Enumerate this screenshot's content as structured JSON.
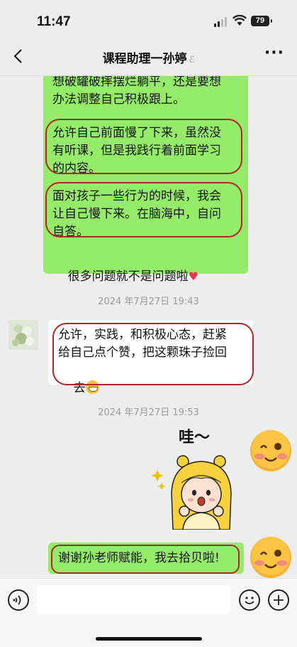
{
  "status": {
    "time": "11:47",
    "battery": "79"
  },
  "nav": {
    "back_icon": "chevron-left-icon",
    "title": "课程助理一孙婷",
    "title_icon": "ear-icon",
    "more_icon": "more-dots-icon"
  },
  "messages": {
    "m1": {
      "line1": "想破罐破摔摆烂躺平，还是要想",
      "line2": "办法调整自己积极跟上。",
      "line3": "允许自己前面慢了下来，虽然没",
      "line4": "有听课，但是我践行着前面学习",
      "line5": "的内容。",
      "line6": "面对孩子一些行为的时候，我会",
      "line7": "让自己慢下来。在脑海中，自问",
      "line8": "自答。",
      "line9": "很多问题就不是问题啦",
      "emoji": "heart-icon"
    },
    "ts1": "2024 年7月27日 19:43",
    "m2": {
      "line1": "允许，实践，和积极心态，赶紧",
      "line2": "给自己点个赞，把这颗珠子捡回",
      "line3": "去",
      "emoji": "grin-emoji-icon"
    },
    "ts2": "2024 年7月27日 19:53",
    "sticker": {
      "text": "哇～",
      "icon": "cartoon-girl-sticker"
    },
    "m3": {
      "text": "谢谢孙老师赋能，我去拾贝啦!"
    }
  },
  "bottom": {
    "voice_icon": "voice-icon",
    "emoji_icon": "emoji-icon",
    "plus_icon": "plus-icon"
  },
  "colors": {
    "bubble_green": "#95ec69",
    "annotation_red": "#b0262a",
    "background": "#ededed"
  }
}
